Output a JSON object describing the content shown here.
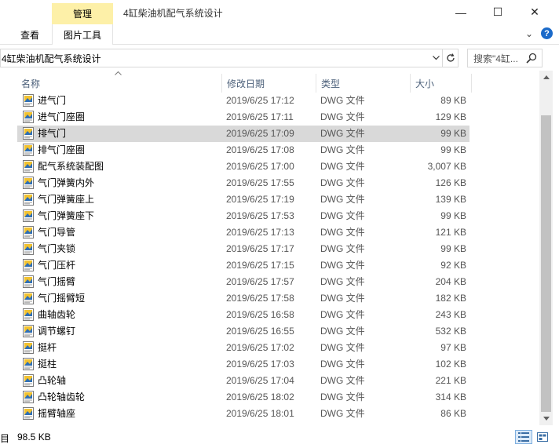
{
  "window": {
    "title": "4缸柴油机配气系统设计",
    "context_tab": "管理",
    "controls": {
      "minimize": "—",
      "maximize": "☐",
      "close": "✕"
    }
  },
  "ribbon": {
    "tabs": [
      {
        "label": "查看"
      },
      {
        "label": "图片工具"
      }
    ],
    "expand": "⌄",
    "help": "?"
  },
  "address": {
    "path": "4缸柴油机配气系统设计",
    "search_placeholder": "搜索\"4缸..."
  },
  "columns": {
    "name": "名称",
    "date": "修改日期",
    "type": "类型",
    "size": "大小"
  },
  "files": [
    {
      "name": "进气门",
      "date": "2019/6/25 17:12",
      "type": "DWG 文件",
      "size": "89 KB"
    },
    {
      "name": "进气门座圈",
      "date": "2019/6/25 17:11",
      "type": "DWG 文件",
      "size": "129 KB"
    },
    {
      "name": "排气门",
      "date": "2019/6/25 17:09",
      "type": "DWG 文件",
      "size": "99 KB",
      "selected": true
    },
    {
      "name": "排气门座圈",
      "date": "2019/6/25 17:08",
      "type": "DWG 文件",
      "size": "99 KB"
    },
    {
      "name": "配气系统装配图",
      "date": "2019/6/25 17:00",
      "type": "DWG 文件",
      "size": "3,007 KB"
    },
    {
      "name": "气门弹簧内外",
      "date": "2019/6/25 17:55",
      "type": "DWG 文件",
      "size": "126 KB"
    },
    {
      "name": "气门弹簧座上",
      "date": "2019/6/25 17:19",
      "type": "DWG 文件",
      "size": "139 KB"
    },
    {
      "name": "气门弹簧座下",
      "date": "2019/6/25 17:53",
      "type": "DWG 文件",
      "size": "99 KB"
    },
    {
      "name": "气门导管",
      "date": "2019/6/25 17:13",
      "type": "DWG 文件",
      "size": "121 KB"
    },
    {
      "name": "气门夹锁",
      "date": "2019/6/25 17:17",
      "type": "DWG 文件",
      "size": "99 KB"
    },
    {
      "name": "气门压杆",
      "date": "2019/6/25 17:15",
      "type": "DWG 文件",
      "size": "92 KB"
    },
    {
      "name": "气门摇臂",
      "date": "2019/6/25 17:57",
      "type": "DWG 文件",
      "size": "204 KB"
    },
    {
      "name": "气门摇臂短",
      "date": "2019/6/25 17:58",
      "type": "DWG 文件",
      "size": "182 KB"
    },
    {
      "name": "曲轴齿轮",
      "date": "2019/6/25 16:58",
      "type": "DWG 文件",
      "size": "243 KB"
    },
    {
      "name": "调节螺钉",
      "date": "2019/6/25 16:55",
      "type": "DWG 文件",
      "size": "532 KB"
    },
    {
      "name": "挺杆",
      "date": "2019/6/25 17:02",
      "type": "DWG 文件",
      "size": "97 KB"
    },
    {
      "name": "挺柱",
      "date": "2019/6/25 17:03",
      "type": "DWG 文件",
      "size": "102 KB"
    },
    {
      "name": "凸轮轴",
      "date": "2019/6/25 17:04",
      "type": "DWG 文件",
      "size": "221 KB"
    },
    {
      "name": "凸轮轴齿轮",
      "date": "2019/6/25 18:02",
      "type": "DWG 文件",
      "size": "314 KB"
    },
    {
      "name": "摇臂轴座",
      "date": "2019/6/25 18:01",
      "type": "DWG 文件",
      "size": "86 KB"
    }
  ],
  "status": {
    "left": "目",
    "selection_size": "98.5 KB"
  },
  "colors": {
    "selected_row": "#d9d9d9",
    "context_tab": "#fdf0a8",
    "header_text": "#4c607a",
    "accent": "#1b6ac9"
  },
  "icons": {
    "file": "dwg-file-icon",
    "search": "search-icon",
    "refresh": "refresh-icon"
  }
}
